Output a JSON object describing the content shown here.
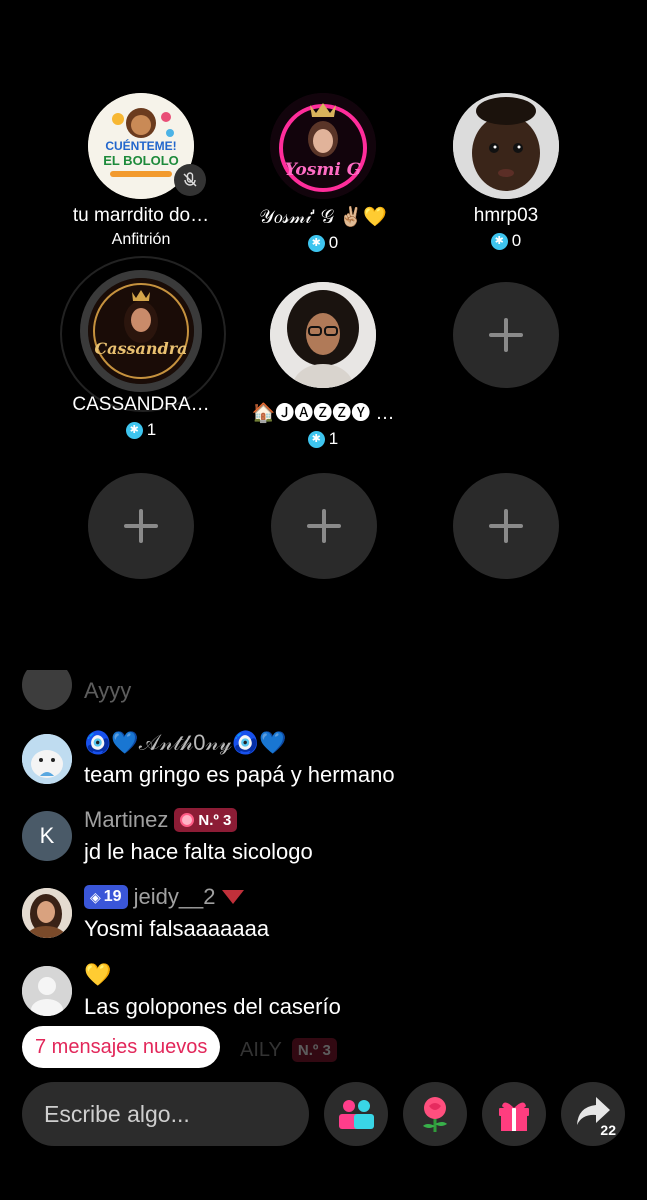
{
  "seats": [
    {
      "name": "tu marrdito do…",
      "sub": "Anfitrión",
      "avatar_text_top": "CUÉNTEME!",
      "avatar_text_bottom": "EL BOLOLO"
    },
    {
      "name": "𝒴𝑜𝓈𝓂𝒾' 𝒢 ✌🏼💛",
      "count": "0",
      "avatar_text": "Yosmi G"
    },
    {
      "name": "hmrp03",
      "count": "0"
    },
    {
      "name": "CASSANDRA…",
      "count": "1",
      "avatar_text": "Cassandra"
    },
    {
      "name": "🏠🅙🅐🅩🅩🅨 …",
      "count": "1"
    }
  ],
  "chat": [
    {
      "user": "",
      "text": "Ayyy"
    },
    {
      "user": "🧿💙𝒜𝓃𝓉𝒽0𝓃𝓎🧿💙",
      "text": "team gringo es papá y hermano"
    },
    {
      "user": "Martinez",
      "avatar_letter": "K",
      "badge": "N.º 3",
      "text": "jd le hace falta sicologo"
    },
    {
      "user": "jeidy__2",
      "level": "19",
      "text": "Yosmi falsaaaaaaa"
    },
    {
      "user": "💛",
      "text": "Las golopones del caserío"
    }
  ],
  "ghost_row": "AILY",
  "ghost_badge": "N.º 3",
  "new_messages": "7 mensajes nuevos",
  "input_placeholder": "Escribe algo...",
  "share_count": "22",
  "colors": {
    "accent": "#e2275a",
    "coin": "#3ec5ef",
    "rank_badge": "#8c1c35",
    "level_badge": "#3a56d8"
  }
}
